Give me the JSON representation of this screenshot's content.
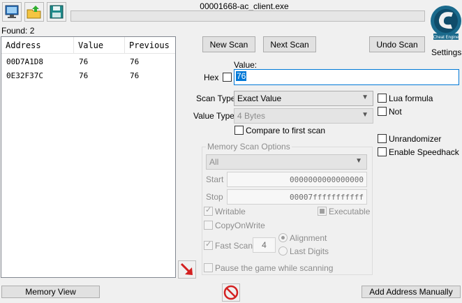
{
  "window": {
    "title": "00001668-ac_client.exe"
  },
  "toolbar": {
    "open_process_icon": "computer-monitor-icon",
    "open_file_icon": "open-folder-icon",
    "save_icon": "floppy-disk-icon"
  },
  "logo": {
    "label": "Settings"
  },
  "found": "Found: 2",
  "results": {
    "columns": [
      "Address",
      "Value",
      "Previous"
    ],
    "rows": [
      {
        "address": "00D7A1D8",
        "value": "76",
        "previous": "76"
      },
      {
        "address": "0E32F37C",
        "value": "76",
        "previous": "76"
      }
    ]
  },
  "scan_buttons": {
    "new_scan": "New Scan",
    "next_scan": "Next Scan",
    "undo_scan": "Undo Scan"
  },
  "value": {
    "label": "Value:",
    "hex_label": "Hex",
    "input": "76"
  },
  "scan_type": {
    "label": "Scan Type",
    "selected": "Exact Value"
  },
  "value_type": {
    "label": "Value Type",
    "selected": "4 Bytes"
  },
  "options": {
    "compare_first": "Compare to first scan",
    "lua_formula": "Lua formula",
    "not": "Not",
    "unrandomizer": "Unrandomizer",
    "speedhack": "Enable Speedhack"
  },
  "memory_scan": {
    "title": "Memory Scan Options",
    "region": "All",
    "start_label": "Start",
    "start_value": "0000000000000000",
    "stop_label": "Stop",
    "stop_value": "00007fffffffffff",
    "writable": "Writable",
    "executable": "Executable",
    "copy_on_write": "CopyOnWrite",
    "fast_scan": "Fast Scan",
    "fast_scan_value": "4",
    "alignment": "Alignment",
    "last_digits": "Last Digits",
    "pause": "Pause the game while scanning"
  },
  "bottom": {
    "memory_view": "Memory View",
    "add_address": "Add Address Manually"
  }
}
